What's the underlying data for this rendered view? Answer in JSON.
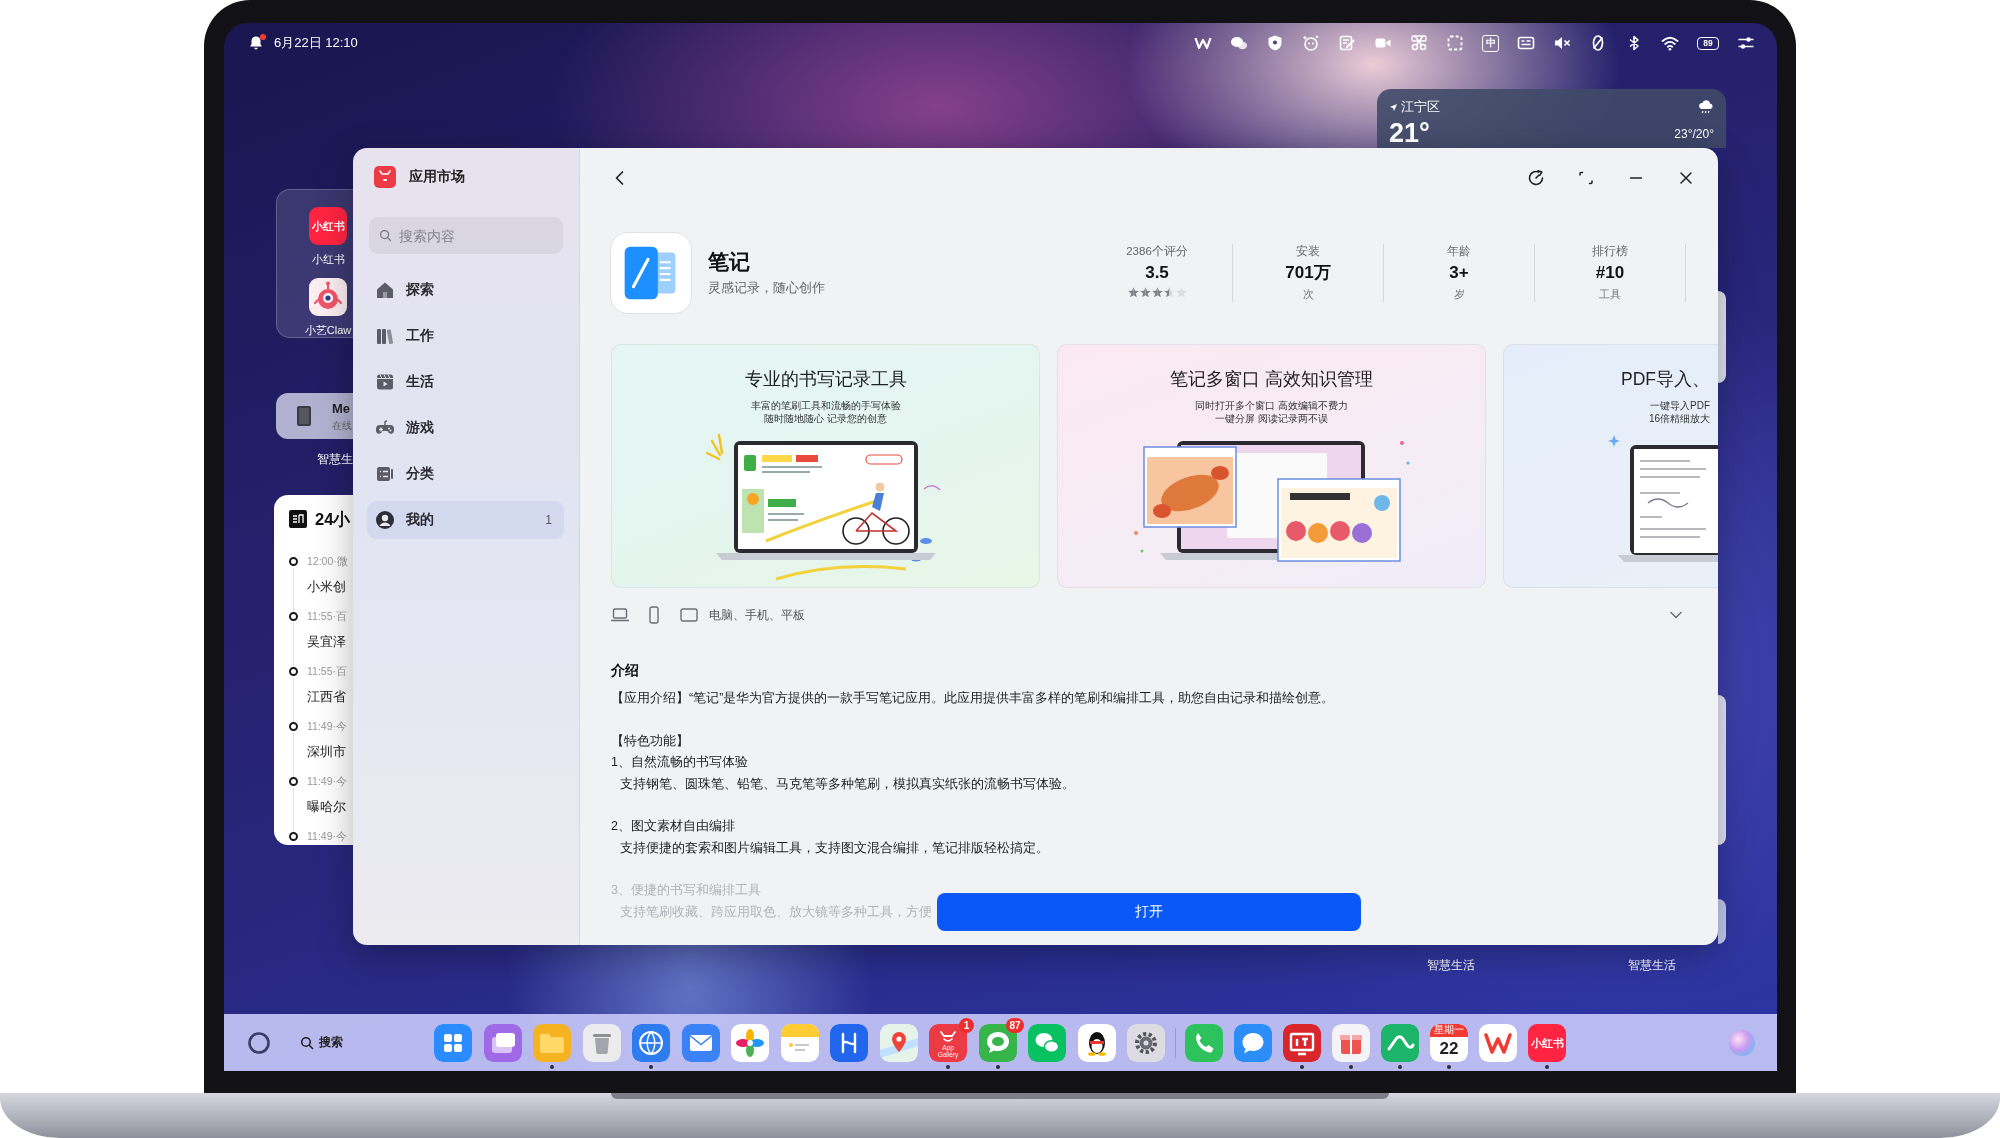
{
  "status_bar": {
    "notification": true,
    "date_time": "6月22日 12:10",
    "input_method": "中",
    "battery": "89"
  },
  "weather_widget": {
    "location": "江宁区",
    "temperature": "21°",
    "range": "23°/20°"
  },
  "left_widgets": {
    "folder_apps": [
      {
        "kind": "xiaohongshu",
        "label": "小红书",
        "logo_text": "小红书"
      },
      {
        "kind": "mascot",
        "label": "小艺Claw"
      }
    ],
    "device": {
      "name": "Me",
      "status": "在线"
    },
    "device_caption": "智慧生",
    "news": {
      "title": "24小",
      "items": [
        {
          "time": "12:00·微",
          "headline": "小米创"
        },
        {
          "time": "11:55·百",
          "headline": "吴宜泽"
        },
        {
          "time": "11:55·百",
          "headline": "江西省"
        },
        {
          "time": "11:49·今",
          "headline": "深圳市"
        },
        {
          "time": "11:49·今",
          "headline": "曝哈尔"
        },
        {
          "time": "11:49·今"
        }
      ]
    }
  },
  "right_widgets": {
    "captions": [
      "智慧生活",
      "智慧生活"
    ]
  },
  "sidebar": {
    "title": "应用市场",
    "search": {
      "placeholder": "搜索内容"
    },
    "items": [
      {
        "kind": "explore",
        "label": "探索",
        "selected": false
      },
      {
        "kind": "work",
        "label": "工作",
        "selected": false
      },
      {
        "kind": "life",
        "label": "生活",
        "selected": false
      },
      {
        "kind": "games",
        "label": "游戏",
        "selected": false
      },
      {
        "kind": "categories",
        "label": "分类",
        "selected": false
      },
      {
        "kind": "profile",
        "label": "我的",
        "selected": true,
        "count": "1"
      }
    ]
  },
  "app": {
    "name": "笔记",
    "tagline": "灵感记录，随心创作"
  },
  "stats": [
    {
      "label": "2386个评分",
      "value": "3.5",
      "stars": 3.5
    },
    {
      "label": "安装",
      "value": "701万",
      "unit": "次"
    },
    {
      "label": "年龄",
      "value": "3+",
      "unit": "岁"
    },
    {
      "label": "排行榜",
      "value": "#10",
      "unit": "工具"
    }
  ],
  "screenshots": [
    {
      "kind": "handwriting",
      "title": "专业的书写记录工具",
      "lines": [
        "丰富的笔刷工具和流畅的手写体验",
        "随时随地随心 记录您的创意"
      ]
    },
    {
      "kind": "multiwindow",
      "title": "笔记多窗口 高效知识管理",
      "lines": [
        "同时打开多个窗口 高效编辑不费力",
        "一键分屏 阅读记录两不误"
      ]
    },
    {
      "kind": "pdf",
      "title": "PDF导入、",
      "lines": [
        "一键导入PDF",
        "16倍精细放大"
      ]
    }
  ],
  "platforms": {
    "text": "电脑、手机、平板",
    "expanded": false
  },
  "description": {
    "title": "介绍",
    "paragraphs": [
      {
        "lines": [
          {
            "kind": "line",
            "text": "【应用介绍】“笔记”是华为官方提供的一款手写笔记应用。此应用提供丰富多样的笔刷和编排工具，助您自由记录和描绘创意。",
            "dimmed": false
          }
        ]
      },
      {
        "lines": [
          {
            "kind": "line",
            "text": "【特色功能】",
            "dimmed": false
          },
          {
            "kind": "line",
            "text": "1、自然流畅的书写体验",
            "dimmed": false
          },
          {
            "kind": "detail",
            "text": "支持钢笔、圆珠笔、铅笔、马克笔等多种笔刷，模拟真实纸张的流畅书写体验。",
            "dimmed": false
          }
        ]
      },
      {
        "lines": [
          {
            "kind": "line",
            "text": "2、图文素材自由编排",
            "dimmed": false
          },
          {
            "kind": "detail",
            "text": "支持便捷的套索和图片编辑工具，支持图文混合编排，笔记排版轻松搞定。",
            "dimmed": false
          }
        ]
      },
      {
        "lines": [
          {
            "kind": "line",
            "text": "3、便捷的书写和编排工具",
            "dimmed": true
          },
          {
            "kind": "detail",
            "text": "支持笔刷收藏、跨应用取色、放大镜等多种工具，方便",
            "dimmed": true
          }
        ]
      }
    ]
  },
  "open_button": {
    "label": "打开"
  },
  "dock": {
    "search_label": "搜索",
    "pinned_apps": [
      {
        "kind": "launcher",
        "running": false
      },
      {
        "kind": "multiwindow",
        "running": false
      },
      {
        "kind": "files",
        "running": true
      },
      {
        "kind": "trash",
        "running": false
      },
      {
        "kind": "browser",
        "running": true
      },
      {
        "kind": "mail",
        "running": false
      },
      {
        "kind": "gallery",
        "running": false
      },
      {
        "kind": "notes",
        "running": false
      },
      {
        "kind": "harmony",
        "running": false
      },
      {
        "kind": "maps",
        "running": false
      },
      {
        "kind": "appstore",
        "running": true,
        "badge": "1",
        "logo_text": "App Gallery"
      },
      {
        "kind": "messages",
        "running": true,
        "badge": "87"
      },
      {
        "kind": "chat",
        "running": false
      },
      {
        "kind": "penguin",
        "running": false
      },
      {
        "kind": "settings",
        "running": false
      }
    ],
    "recent_apps": [
      {
        "kind": "phone",
        "running": false
      },
      {
        "kind": "message",
        "running": false
      },
      {
        "kind": "news",
        "running": true
      },
      {
        "kind": "box",
        "running": true
      },
      {
        "kind": "link",
        "running": true
      },
      {
        "kind": "calendar",
        "running": true,
        "logo_text": "星期一",
        "date": "22"
      },
      {
        "kind": "wps",
        "running": false
      },
      {
        "kind": "xiaohongshu",
        "running": true,
        "logo_text": "小红书"
      }
    ]
  }
}
